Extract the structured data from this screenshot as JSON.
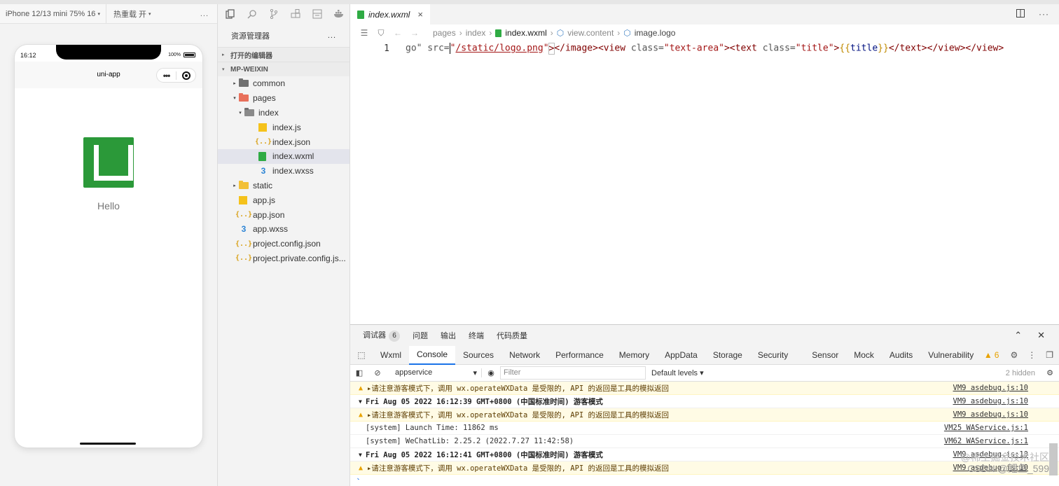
{
  "simulator": {
    "device": "iPhone 12/13 mini 75% 16",
    "hot_reload": "热重载 开",
    "more": "...",
    "status_time": "16:12",
    "battery": "100%",
    "nav_title": "uni-app",
    "capsule_dots": "•••",
    "page_text": "Hello"
  },
  "explorer": {
    "title": "资源管理器",
    "more": "...",
    "open_editors": "打开的编辑器",
    "project": "MP-WEIXIN",
    "tree": [
      {
        "label": "common",
        "depth": 1,
        "type": "folder",
        "caret": "▸"
      },
      {
        "label": "pages",
        "depth": 1,
        "type": "folder-orange",
        "caret": "▾"
      },
      {
        "label": "index",
        "depth": 2,
        "type": "folder-open",
        "caret": "▾"
      },
      {
        "label": "index.js",
        "depth": 3,
        "type": "js",
        "caret": ""
      },
      {
        "label": "index.json",
        "depth": 3,
        "type": "json",
        "caret": ""
      },
      {
        "label": "index.wxml",
        "depth": 3,
        "type": "wxml",
        "caret": "",
        "selected": true
      },
      {
        "label": "index.wxss",
        "depth": 3,
        "type": "wxss",
        "caret": ""
      },
      {
        "label": "static",
        "depth": 1,
        "type": "folder-yellow",
        "caret": "▸"
      },
      {
        "label": "app.js",
        "depth": 1,
        "type": "js",
        "caret": ""
      },
      {
        "label": "app.json",
        "depth": 1,
        "type": "json",
        "caret": ""
      },
      {
        "label": "app.wxss",
        "depth": 1,
        "type": "wxss",
        "caret": ""
      },
      {
        "label": "project.config.json",
        "depth": 1,
        "type": "json",
        "caret": ""
      },
      {
        "label": "project.private.config.js...",
        "depth": 1,
        "type": "json",
        "caret": ""
      }
    ]
  },
  "editor": {
    "tab_label": "index.wxml",
    "close": "×",
    "breadcrumbs": [
      "pages",
      "index",
      "index.wxml",
      "view.content",
      "image.logo"
    ],
    "line_number": "1",
    "code": {
      "a": "go\" src=",
      "b": "\"",
      "c": "/static/logo.png",
      "d": "\"",
      "e": ">",
      "f": "</image><view ",
      "g": "class=",
      "h": "\"text-area\"",
      "i": "><text ",
      "j": "class=",
      "k": "\"title\"",
      "l": ">",
      "m": "{{",
      "n": "title",
      "o": "}}",
      "p": "</text></view></view>"
    }
  },
  "devtools": {
    "top_tabs": [
      "调试器",
      "问题",
      "输出",
      "终端",
      "代码质量"
    ],
    "debugger_badge": "6",
    "panel_tabs": [
      "Wxml",
      "Console",
      "Sources",
      "Network",
      "Performance",
      "Memory",
      "AppData",
      "Storage",
      "Security",
      "Sensor",
      "Mock",
      "Audits",
      "Vulnerability"
    ],
    "active_tab": "Console",
    "warn_count": "6",
    "context": "appservice",
    "filter_placeholder": "Filter",
    "levels": "Default levels ▾",
    "hidden": "2 hidden",
    "console_rows": [
      {
        "kind": "warn",
        "text": "▸请注意游客模式下，调用 wx.operateWXData 是受限的, API 的返回是工具的模拟返回",
        "src": "VM9 asdebug.js:10"
      },
      {
        "kind": "group",
        "text": "Fri Aug 05 2022 16:12:39 GMT+0800 (中国标准时间) 游客模式",
        "src": "VM9 asdebug.js:10"
      },
      {
        "kind": "warn",
        "text": "▸请注意游客模式下，调用 wx.operateWXData 是受限的, API 的返回是工具的模拟返回",
        "src": "VM9 asdebug.js:10"
      },
      {
        "kind": "log",
        "text": "[system] Launch Time: 11862 ms",
        "src": "VM25 WAService.js:1"
      },
      {
        "kind": "log",
        "text": "[system] WeChatLib: 2.25.2 (2022.7.27 11:42:58)",
        "src": "VM62 WAService.js:1"
      },
      {
        "kind": "group",
        "text": "Fri Aug 05 2022 16:12:41 GMT+0800 (中国标准时间) 游客模式",
        "src": "VM9 asdebug.js:10"
      },
      {
        "kind": "warn",
        "text": "▸请注意游客模式下，调用 wx.operateWXData 是受限的, API 的返回是工具的模拟返回",
        "src": "VM9 asdebug.js:10"
      }
    ],
    "prompt": "›",
    "watermark_line1": "@稀土掘金技术社区",
    "watermark_line2": "CSDN @鲤鱼_599"
  }
}
